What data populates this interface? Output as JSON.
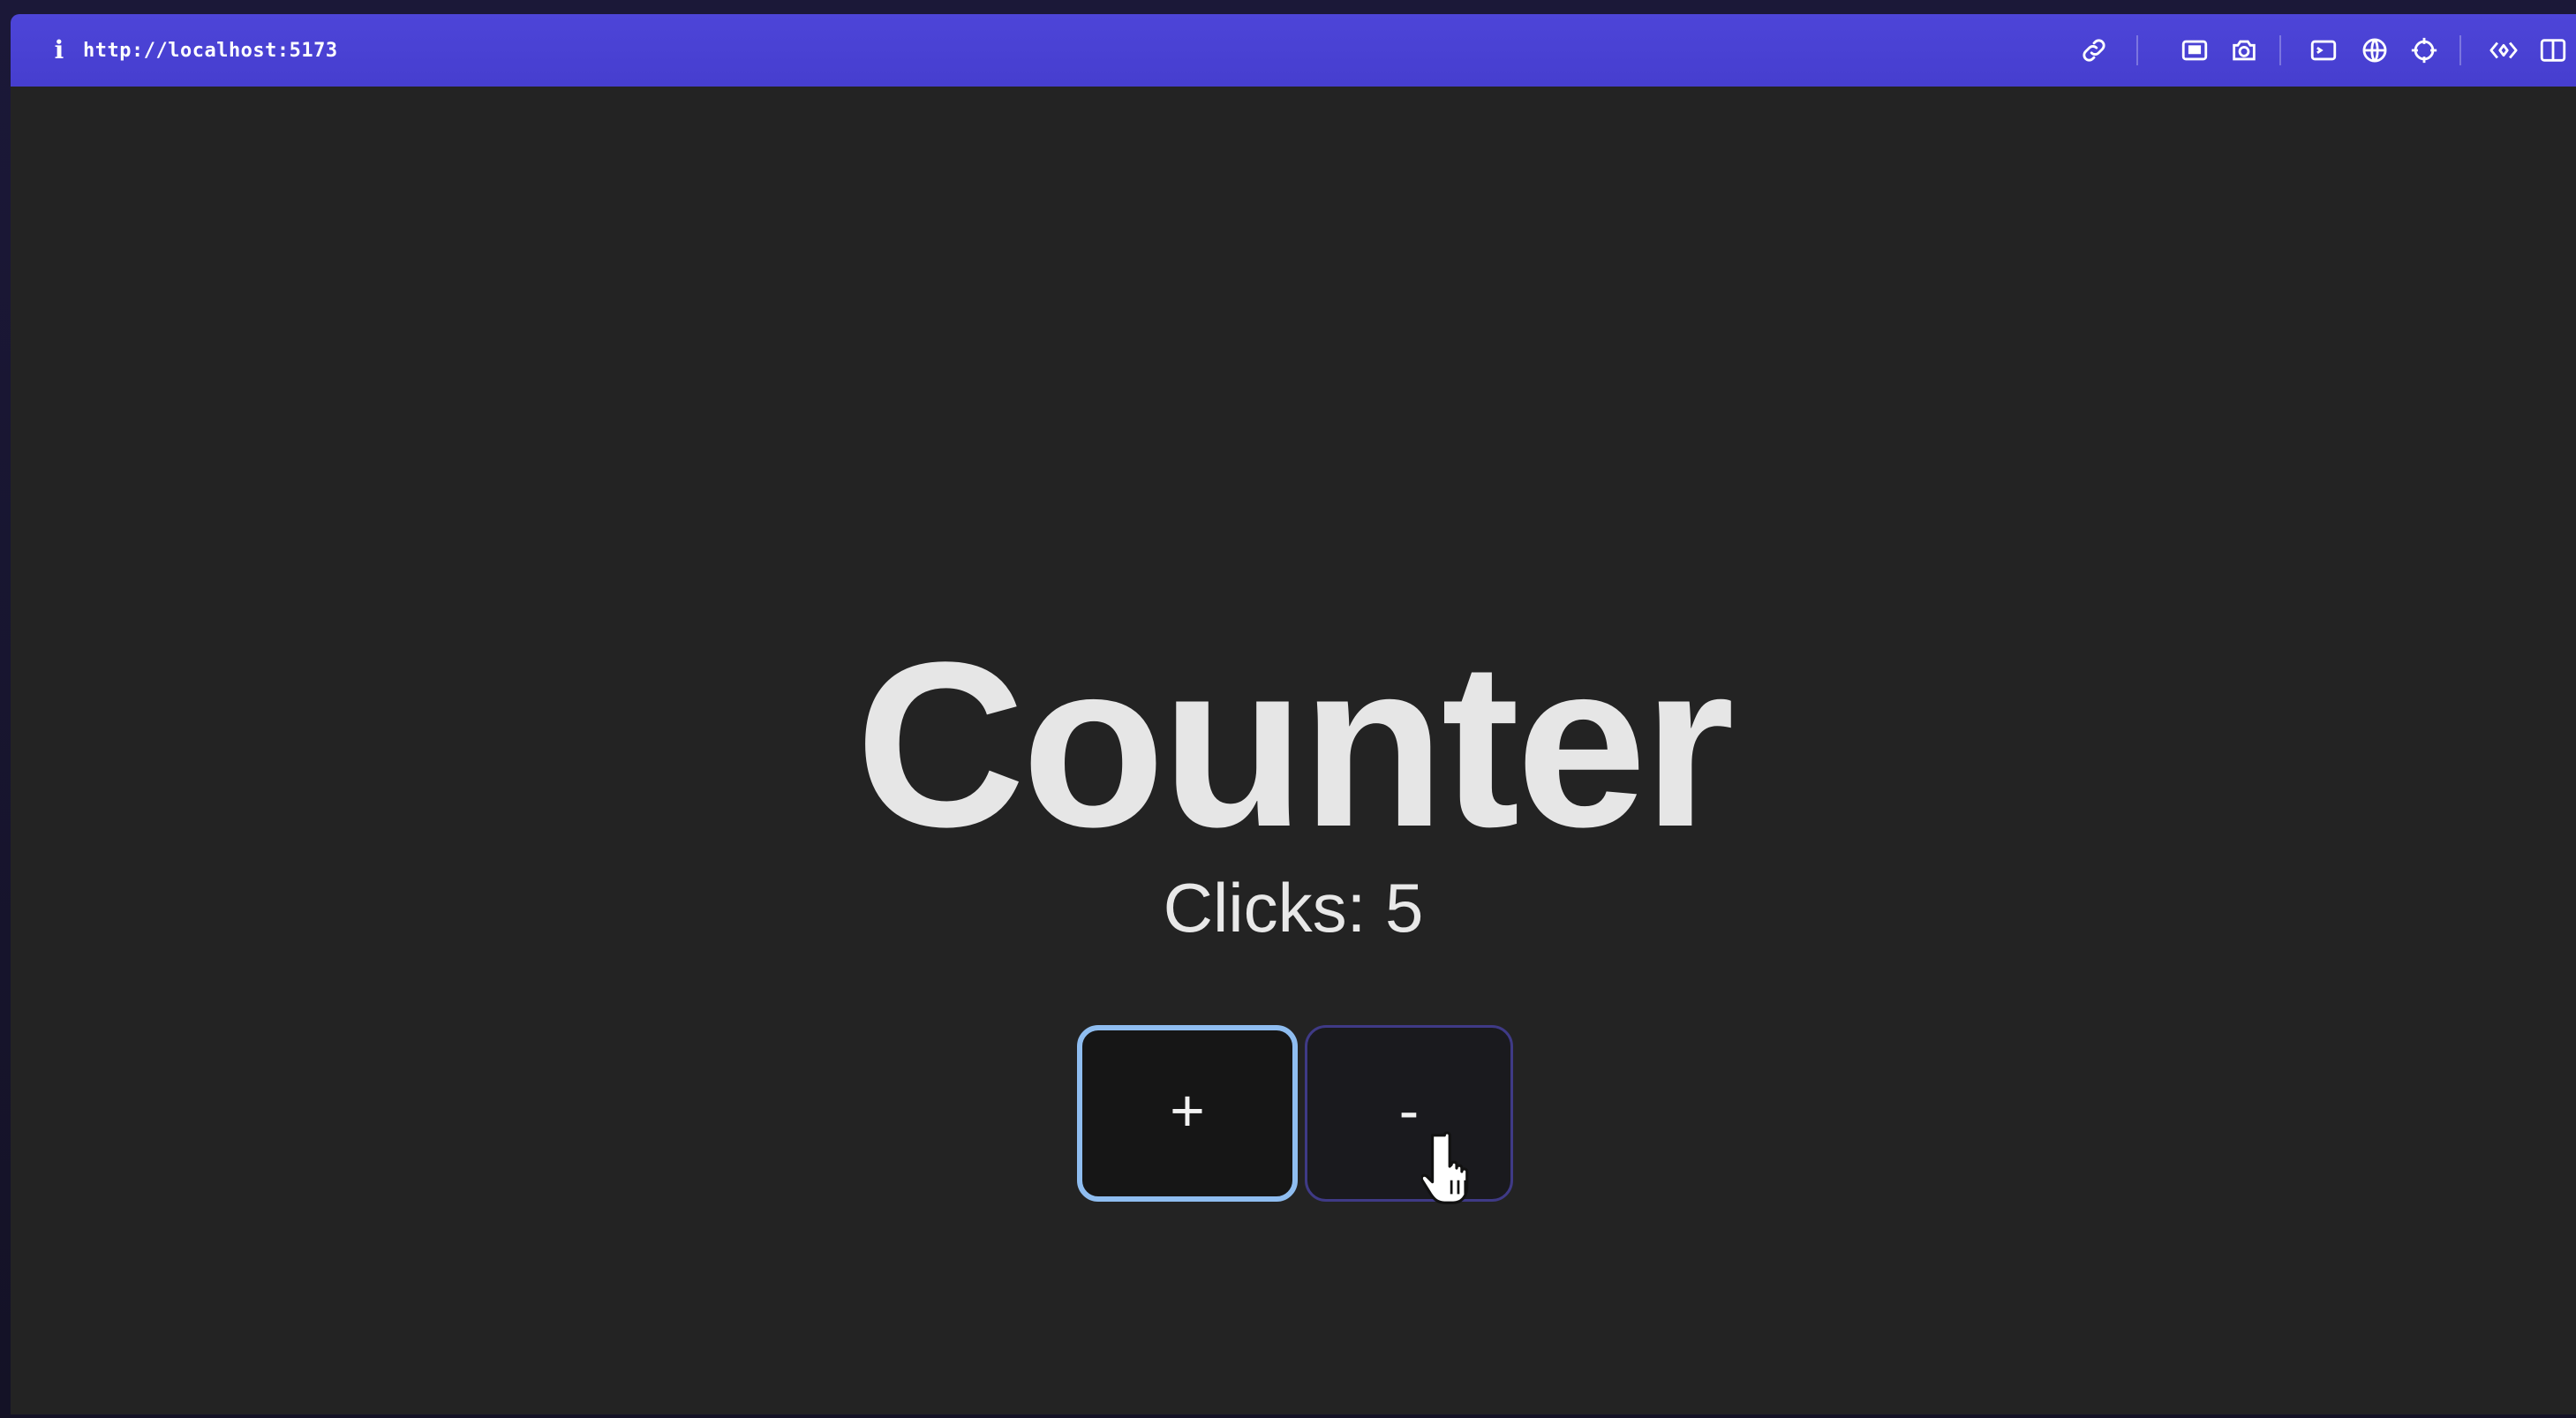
{
  "browser": {
    "url": "http://localhost:5173",
    "icons": {
      "info": "info-icon",
      "link": "link-icon",
      "screenshot_area": "capture-area-icon",
      "camera": "camera-icon",
      "terminal": "terminal-icon",
      "globe": "globe-icon",
      "target": "crosshair-icon",
      "code": "code-icon",
      "split": "split-view-icon"
    },
    "accent_color": "#4c44d6"
  },
  "page": {
    "title": "Counter",
    "clicks_text": "Clicks: 5",
    "buttons": {
      "increment_label": "+",
      "decrement_label": "-"
    },
    "focus_color": "#8fbdf0",
    "background_color": "#232323"
  }
}
